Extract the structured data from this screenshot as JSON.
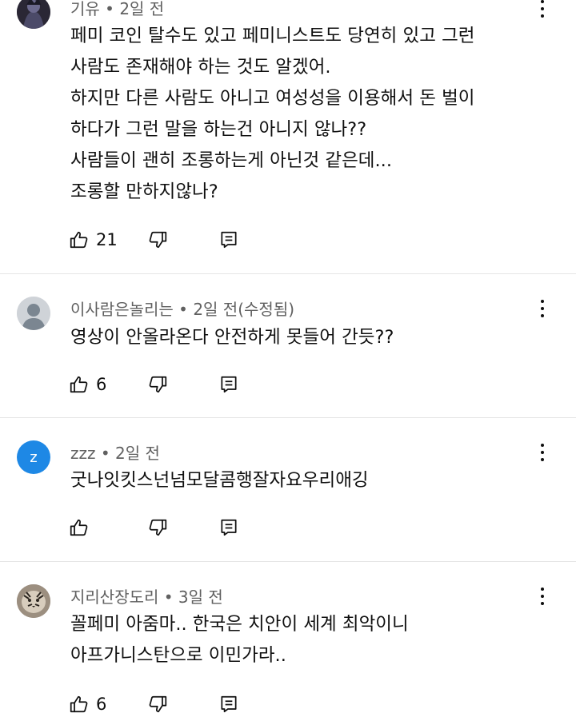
{
  "comments": [
    {
      "author": "기유",
      "time": "2일 전",
      "lines": [
        "페미 코인 탈수도 있고 페미니스트도 당연히 있고 그런",
        "사람도 존재해야 하는 것도 알겠어.",
        "하지만 다른 사람도 아니고 여성성을 이용해서 돈 벌이",
        "하다가 그런 말을 하는건 아니지 않나??",
        "사람들이 괜히 조롱하는게 아닌것 같은데...",
        "조롱할 만하지않나?"
      ],
      "likes": "21"
    },
    {
      "author": "이사람은놀리는",
      "time": "2일 전(수정됨)",
      "lines": [
        "영상이 안올라온다 안전하게 못들어 간듯??"
      ],
      "likes": "6"
    },
    {
      "author": "zzz",
      "avatar_letter": "z",
      "avatar_color": "#1e88e5",
      "time": "2일 전",
      "lines": [
        "굿나잇킷스넌넘모달콤행잘자요우리애깅"
      ],
      "likes": ""
    },
    {
      "author": "지리산장도리",
      "time": "3일 전",
      "lines": [
        "꼴페미 아줌마.. 한국은 치안이 세계 최악이니",
        "아프가니스탄으로 이민가라.."
      ],
      "likes": "6"
    }
  ],
  "icons": {
    "like": "thumbs-up-icon",
    "dislike": "thumbs-down-icon",
    "reply": "reply-comment-icon",
    "more": "more-vertical-icon"
  }
}
